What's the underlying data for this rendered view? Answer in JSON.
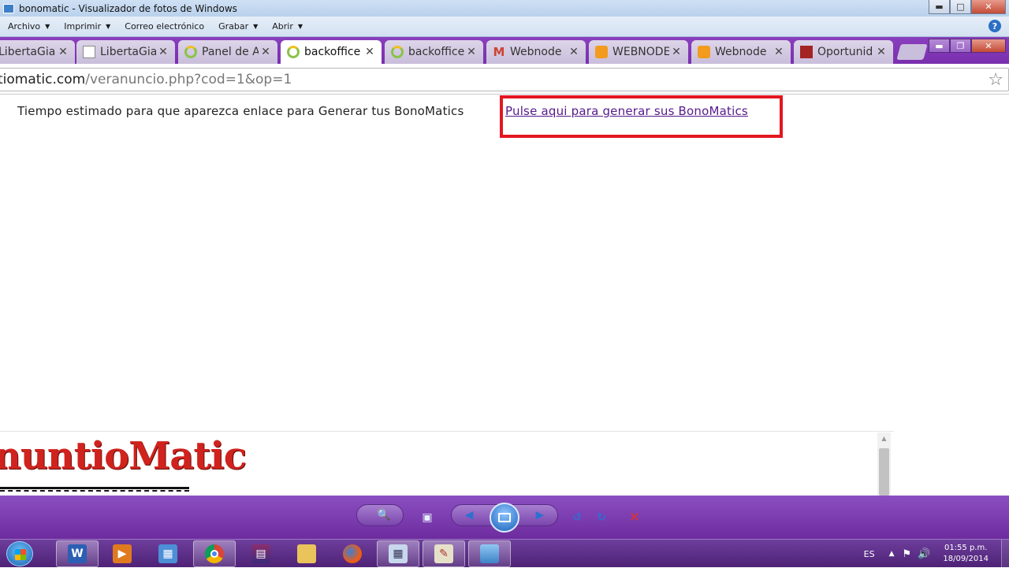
{
  "window": {
    "title": "bonomatic - Visualizador de fotos de Windows"
  },
  "menu": {
    "items": [
      "Archivo",
      "Imprimir",
      "Correo electrónico",
      "Grabar",
      "Abrir"
    ],
    "help": "?"
  },
  "tabs": [
    {
      "label": "LibertaGia",
      "icon": "page-icon",
      "active": false
    },
    {
      "label": "LibertaGia",
      "icon": "page-icon",
      "active": false
    },
    {
      "label": "Panel de A",
      "icon": "ring-icon",
      "active": false
    },
    {
      "label": "backoffice",
      "icon": "ring-icon",
      "active": true
    },
    {
      "label": "backoffice",
      "icon": "ring-icon",
      "active": false
    },
    {
      "label": "Webnode",
      "icon": "gmail-icon",
      "active": false
    },
    {
      "label": "WEBNODE",
      "icon": "owl-icon",
      "active": false
    },
    {
      "label": "Webnode",
      "icon": "owl-icon",
      "active": false
    },
    {
      "label": "Oportunid",
      "icon": "book-icon",
      "active": false
    }
  ],
  "omnibox": {
    "host": "tiomatic.com",
    "path": "/veranuncio.php?cod=1&op=1"
  },
  "page": {
    "estimate_text": "Tiempo estimado para que aparezca enlace para Generar tus BonoMatics",
    "link_text": "Pulse aqui para generar sus BonoMatics",
    "logo_text": "nuntioMatic"
  },
  "taskbar": {
    "language": "ES",
    "time": "01:55 p.m.",
    "date": "18/09/2014"
  },
  "colors": {
    "highlight_box": "#e3161f",
    "visited_link": "#551a8b",
    "chrome_frame": "#7a2fae"
  }
}
